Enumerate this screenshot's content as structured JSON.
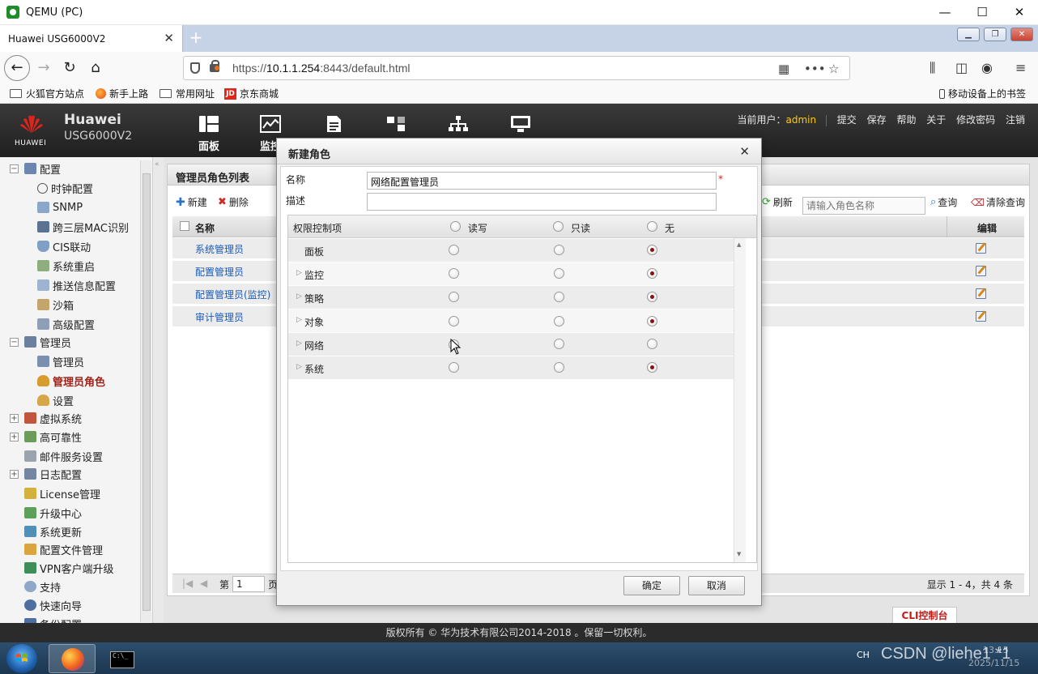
{
  "window": {
    "title": "QEMU (PC)",
    "minimize": "—",
    "maximize": "☐",
    "close": "✕"
  },
  "browser": {
    "tab_title": "Huawei USG6000V2",
    "tab_close": "✕",
    "new_tab": "+",
    "url_scheme": "https://",
    "url_host": "10.1.1.254",
    "url_rest": ":8443/default.html",
    "bookmarks": [
      {
        "label": "火狐官方站点",
        "icon": "folder-icon"
      },
      {
        "label": "新手上路",
        "icon": "firefox-icon"
      },
      {
        "label": "常用网址",
        "icon": "folder-icon"
      },
      {
        "label": "京东商城",
        "icon": "jd-icon"
      }
    ],
    "mobile_bookmarks": "移动设备上的书签"
  },
  "app": {
    "brand_line1": "Huawei",
    "brand_line2": "USG6000V2",
    "logo_text": "HUAWEI",
    "top_nav": [
      {
        "label": "面板",
        "icon": "dashboard-icon"
      },
      {
        "label": "监控",
        "icon": "monitor-chart-icon"
      },
      {
        "label": "",
        "icon": "policy-doc-icon"
      },
      {
        "label": "",
        "icon": "object-icon"
      },
      {
        "label": "",
        "icon": "network-icon"
      },
      {
        "label": "",
        "icon": "system-icon"
      }
    ],
    "current_user_label": "当前用户：",
    "current_user": "admin",
    "user_links": [
      "提交",
      "保存",
      "帮助",
      "关于",
      "修改密码",
      "注销"
    ]
  },
  "sidebar": {
    "items": [
      {
        "label": "配置",
        "level": 0,
        "expander": "−",
        "icon": "config-icon"
      },
      {
        "label": "时钟配置",
        "level": 1,
        "icon": "clock-icon"
      },
      {
        "label": "SNMP",
        "level": 1,
        "icon": "snmp-icon"
      },
      {
        "label": "跨三层MAC识别",
        "level": 1,
        "icon": "mac-icon"
      },
      {
        "label": "CIS联动",
        "level": 1,
        "icon": "cis-icon"
      },
      {
        "label": "系统重启",
        "level": 1,
        "icon": "restart-icon"
      },
      {
        "label": "推送信息配置",
        "level": 1,
        "icon": "push-icon"
      },
      {
        "label": "沙箱",
        "level": 1,
        "icon": "sandbox-icon"
      },
      {
        "label": "高级配置",
        "level": 1,
        "icon": "advanced-icon"
      },
      {
        "label": "管理员",
        "level": 0,
        "expander": "−",
        "icon": "admin-group-icon"
      },
      {
        "label": "管理员",
        "level": 1,
        "icon": "admin-icon"
      },
      {
        "label": "管理员角色",
        "level": 1,
        "icon": "admin-role-icon",
        "selected": true
      },
      {
        "label": "设置",
        "level": 1,
        "icon": "settings-icon"
      },
      {
        "label": "虚拟系统",
        "level": 0,
        "expander": "+",
        "icon": "vsys-icon"
      },
      {
        "label": "高可靠性",
        "level": 0,
        "expander": "+",
        "icon": "ha-icon"
      },
      {
        "label": "邮件服务设置",
        "level": 0,
        "icon": "mail-icon"
      },
      {
        "label": "日志配置",
        "level": 0,
        "expander": "+",
        "icon": "log-icon"
      },
      {
        "label": "License管理",
        "level": 0,
        "icon": "license-icon"
      },
      {
        "label": "升级中心",
        "level": 0,
        "icon": "upgrade-icon"
      },
      {
        "label": "系统更新",
        "level": 0,
        "icon": "update-icon"
      },
      {
        "label": "配置文件管理",
        "level": 0,
        "icon": "config-file-icon"
      },
      {
        "label": "VPN客户端升级",
        "level": 0,
        "icon": "vpn-icon"
      },
      {
        "label": "支持",
        "level": 0,
        "icon": "support-icon"
      },
      {
        "label": "快速向导",
        "level": 0,
        "icon": "wizard-icon"
      },
      {
        "label": "备份配置",
        "level": 0,
        "icon": "backup-icon"
      }
    ]
  },
  "list_panel": {
    "title": "管理员角色列表",
    "new_label": "新建",
    "delete_label": "删除",
    "refresh_label": "刷新",
    "search_placeholder": "请输入角色名称",
    "query_label": "查询",
    "clear_label": "清除查询",
    "col_name": "名称",
    "col_edit": "编辑",
    "rows": [
      "系统管理员",
      "配置管理员",
      "配置管理员(监控)",
      "审计管理员"
    ],
    "pager_page_label": "第",
    "pager_page": "1",
    "pager_page_suffix": "页",
    "pager_summary": "显示 1 - 4，共 4 条",
    "cli_tab": "CLI控制台"
  },
  "dialog": {
    "title": "新建角色",
    "close": "✕",
    "name_label": "名称",
    "name_value": "网络配置管理员",
    "required_mark": "*",
    "desc_label": "描述",
    "desc_value": "",
    "perm_header": "权限控制项",
    "col_readwrite": "读写",
    "col_readonly": "只读",
    "col_none": "无",
    "perm_rows": [
      {
        "label": "面板",
        "expandable": false,
        "selected": "none"
      },
      {
        "label": "监控",
        "expandable": true,
        "selected": "none"
      },
      {
        "label": "策略",
        "expandable": true,
        "selected": "none"
      },
      {
        "label": "对象",
        "expandable": true,
        "selected": "none"
      },
      {
        "label": "网络",
        "expandable": true,
        "selected": "readwrite"
      },
      {
        "label": "系统",
        "expandable": true,
        "selected": "none"
      }
    ],
    "ok_label": "确定",
    "cancel_label": "取消"
  },
  "footer": {
    "copyright": "版权所有 © 华为技术有限公司2014-2018 。保留一切权利。"
  },
  "taskbar": {
    "input_lang": "CH",
    "watermark": "CSDN @liehe1 *1",
    "time": "13:15",
    "date": "2025/11/15"
  }
}
